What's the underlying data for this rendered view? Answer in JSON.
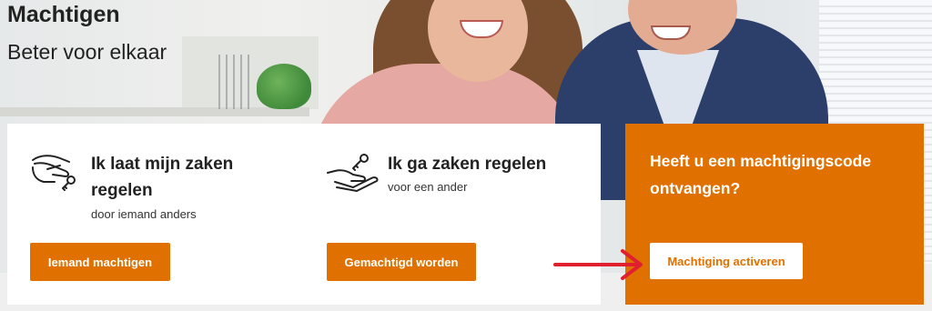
{
  "page": {
    "title": "Machtigen",
    "subtitle": "Beter voor elkaar"
  },
  "options": [
    {
      "title": "Ik laat mijn zaken regelen",
      "subtitle": "door iemand anders",
      "button_label": "Iemand machtigen",
      "icon": "hand-giving-key-icon"
    },
    {
      "title": "Ik ga zaken regelen",
      "subtitle": "voor een ander",
      "button_label": "Gemachtigd worden",
      "icon": "hand-receiving-key-icon"
    }
  ],
  "activation": {
    "title": "Heeft u een machtigingscode ontvangen?",
    "button_label": "Machtiging activeren"
  },
  "annotation": {
    "icon": "red-arrow-icon",
    "color": "#e0202e"
  },
  "colors": {
    "brand_orange": "#e07000",
    "card_white": "#ffffff",
    "text_dark": "#222222"
  }
}
